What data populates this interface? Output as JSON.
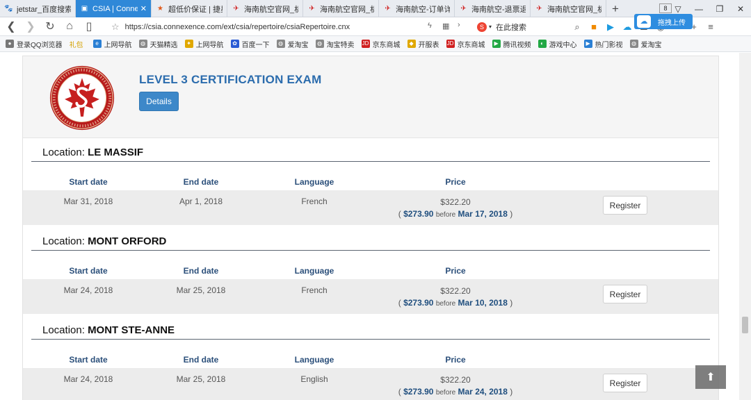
{
  "tabs": [
    {
      "label": "jetstar_百度搜索",
      "icon": "paw-icon",
      "active": false
    },
    {
      "label": "CSIA | Connexe",
      "icon": "page-icon",
      "active": true
    },
    {
      "label": "超低价保证 | 捷星",
      "icon": "star-icon",
      "active": false
    },
    {
      "label": "海南航空官网_机",
      "icon": "hainan-airlines-icon",
      "active": false
    },
    {
      "label": "海南航空官网_机",
      "icon": "hainan-airlines-icon",
      "active": false
    },
    {
      "label": "海南航空-订单详",
      "icon": "hainan-airlines-icon",
      "active": false
    },
    {
      "label": "海南航空-退票退",
      "icon": "hainan-airlines-icon",
      "active": false
    },
    {
      "label": "海南航空官网_机",
      "icon": "hainan-airlines-icon",
      "active": false
    }
  ],
  "tab_count": "8",
  "address": {
    "url": "https://csia.connexence.com/ext/csia/repertoire/csiaRepertoire.cnx",
    "search_placeholder": "在此搜索"
  },
  "upload_popup": "拖拽上传",
  "bookmarks": [
    {
      "label": "登录QQ浏览器",
      "icon": "user-icon",
      "color": "#777"
    },
    {
      "label": "礼包",
      "icon": "gift-icon",
      "color": "#d4a100"
    },
    {
      "label": "上网导航",
      "icon": "e-icon",
      "color": "#2a7fd4"
    },
    {
      "label": "天猫精选",
      "icon": "globe-icon",
      "color": "#888"
    },
    {
      "label": "上网导航",
      "icon": "compass-icon",
      "color": "#e0a800"
    },
    {
      "label": "百度一下",
      "icon": "paw-icon",
      "color": "#2a5bd4"
    },
    {
      "label": "爱淘宝",
      "icon": "globe-icon",
      "color": "#888"
    },
    {
      "label": "淘宝特卖",
      "icon": "globe-icon",
      "color": "#888"
    },
    {
      "label": "京东商城",
      "icon": "jd-icon",
      "color": "#d02020"
    },
    {
      "label": "开服表",
      "icon": "game-icon",
      "color": "#e0a800"
    },
    {
      "label": "京东商城",
      "icon": "jd-icon",
      "color": "#d02020"
    },
    {
      "label": "腾讯视频",
      "icon": "play-icon",
      "color": "#22a845"
    },
    {
      "label": "游戏中心",
      "icon": "gamepad-icon",
      "color": "#22a845"
    },
    {
      "label": "热门影视",
      "icon": "film-icon",
      "color": "#2a7fd4"
    },
    {
      "label": "爱淘宝",
      "icon": "globe-icon",
      "color": "#888"
    }
  ],
  "exam": {
    "title": "LEVEL 3 CERTIFICATION EXAM",
    "details_label": "Details"
  },
  "columns": {
    "start": "Start date",
    "end": "End date",
    "language": "Language",
    "price": "Price"
  },
  "location_prefix": "Location:",
  "locations": [
    {
      "name": "LE MASSIF",
      "start": "Mar 31, 2018",
      "end": "Apr 1, 2018",
      "language": "French",
      "price": "$322.20",
      "early_price": "$273.90",
      "before_word": "before",
      "early_date": "Mar 17, 2018",
      "register_label": "Register"
    },
    {
      "name": "MONT ORFORD",
      "start": "Mar 24, 2018",
      "end": "Mar 25, 2018",
      "language": "French",
      "price": "$322.20",
      "early_price": "$273.90",
      "before_word": "before",
      "early_date": "Mar 10, 2018",
      "register_label": "Register"
    },
    {
      "name": "MONT STE-ANNE",
      "start": "Mar 24, 2018",
      "end": "Mar 25, 2018",
      "language": "English",
      "price": "$322.20",
      "early_price": "$273.90",
      "before_word": "before",
      "early_date": "Mar 24, 2018",
      "register_label": "Register"
    }
  ],
  "colors": {
    "accent": "#2b6cad",
    "button": "#3d88c9",
    "active_tab": "#2f88d8",
    "row_bg": "#ececec"
  }
}
